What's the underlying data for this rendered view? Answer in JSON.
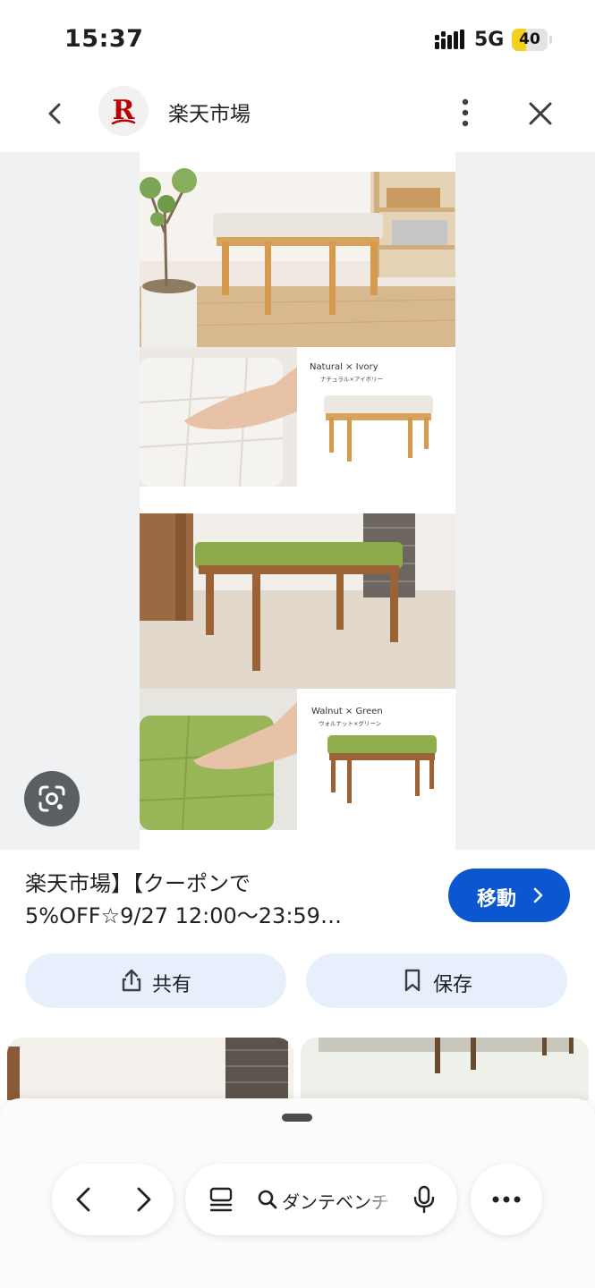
{
  "status_bar": {
    "time": "15:37",
    "network": "5G",
    "battery_level": "40",
    "battery_fraction": 0.4,
    "battery_color": "#f3d11c"
  },
  "top_bar": {
    "site_logo_letter": "R",
    "site_name": "楽天市場",
    "brand_color": "#bf0000"
  },
  "image": {
    "label_natural_en": "Natural × Ivory",
    "label_natural_ja": "ナチュラル×アイボリー",
    "label_walnut_en": "Walnut × Green",
    "label_walnut_ja": "ウォルナット×グリーン"
  },
  "result": {
    "title_line1": "楽天市場】【クーポンで",
    "title_line2": "5%OFF☆9/27 12:00〜23:59…",
    "visit_label": "移動",
    "accent_color": "#0b57d0"
  },
  "actions": {
    "share_label": "共有",
    "save_label": "保存"
  },
  "bottom_bar": {
    "search_text": "ダンテベンチ",
    "icons": [
      "back-icon",
      "forward-icon",
      "tabs-icon",
      "search-icon",
      "mic-icon",
      "more-dots-icon"
    ]
  }
}
